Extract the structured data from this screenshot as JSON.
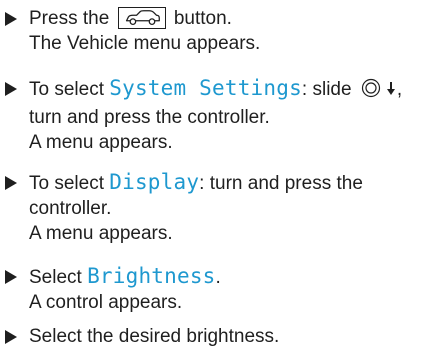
{
  "steps": [
    {
      "line1_pre": "Press the",
      "line1_post": "button.",
      "line2": "The Vehicle menu appears."
    },
    {
      "line1_pre": "To select ",
      "highlight": "System Settings",
      "line1_post": ": slide",
      "line1_end": ",",
      "line2": "turn and press the controller.",
      "line3": "A menu appears."
    },
    {
      "line1_pre": "To select ",
      "highlight": "Display",
      "line1_post": ": turn and press the",
      "line2": "controller.",
      "line3": "A menu appears."
    },
    {
      "line1_pre": "Select ",
      "highlight": "Brightness",
      "line1_post": ".",
      "line2": "A control appears."
    },
    {
      "line1_pre": "Select the desired brightness."
    }
  ],
  "icons": {
    "bullet": "triangle-bullet-icon",
    "vehicle_button": "car-icon",
    "controller": "controller-icon",
    "slide_down": "slide-down-arrow-icon"
  },
  "colors": {
    "highlight": "#1e98cf",
    "text": "#1f1f1f"
  }
}
